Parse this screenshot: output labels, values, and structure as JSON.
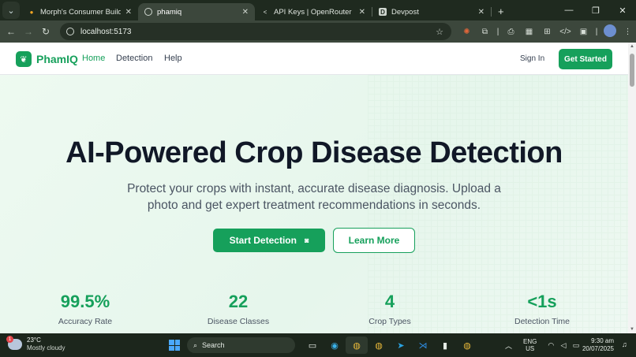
{
  "browser": {
    "tabs": [
      {
        "title": "Morph's Consumer Buildathon",
        "favicon": "morph-icon",
        "active": false
      },
      {
        "title": "phamiq",
        "favicon": "globe-icon",
        "active": true
      },
      {
        "title": "API Keys | OpenRouter",
        "favicon": "openrouter-icon",
        "active": false
      },
      {
        "title": "Devpost",
        "favicon": "D",
        "active": false
      }
    ],
    "address": "localhost:5173"
  },
  "header": {
    "brand": "PhamIQ",
    "nav": {
      "home": "Home",
      "detection": "Detection",
      "help": "Help"
    },
    "sign_in": "Sign In",
    "get_started": "Get Started"
  },
  "hero": {
    "title": "AI-Powered Crop Disease Detection",
    "subtitle": "Protect your crops with instant, accurate disease diagnosis. Upload a photo and get expert treatment recommendations in seconds.",
    "start_button": "Start Detection",
    "learn_button": "Learn More"
  },
  "stats": [
    {
      "value": "99.5%",
      "label": "Accuracy Rate"
    },
    {
      "value": "22",
      "label": "Disease Classes"
    },
    {
      "value": "4",
      "label": "Crop Types"
    },
    {
      "value": "<1s",
      "label": "Detection Time"
    }
  ],
  "taskbar": {
    "weather_temp": "23°C",
    "weather_desc": "Mostly cloudy",
    "weather_badge": "1",
    "search_label": "Search",
    "lang_line1": "ENG",
    "lang_line2": "US",
    "time": "9:30 am",
    "date": "20/07/2025"
  },
  "colors": {
    "accent": "#16a05b",
    "title": "#111827",
    "body": "#4b5563"
  }
}
